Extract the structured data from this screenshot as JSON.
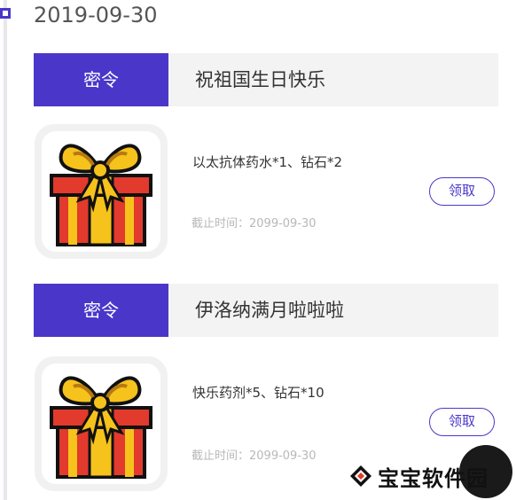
{
  "timeline": {
    "date": "2019-09-30"
  },
  "cards": [
    {
      "tag": "密令",
      "title": "祝祖国生日快乐",
      "rewards": "以太抗体药水*1、钻石*2",
      "deadline": "截止时间：2099-09-30",
      "button_label": "领取"
    },
    {
      "tag": "密令",
      "title": "伊洛纳满月啦啦啦",
      "rewards": "快乐药剂*5、钻石*10",
      "deadline": "截止时间：2099-09-30",
      "button_label": "领取"
    }
  ],
  "watermark": {
    "text": "宝宝软件园",
    "icon": "diamond-logo-icon"
  },
  "colors": {
    "accent": "#4a37c9",
    "header_bg": "#f3f3f3",
    "gift_red": "#e23a2c",
    "gift_gold": "#f6c21c"
  }
}
